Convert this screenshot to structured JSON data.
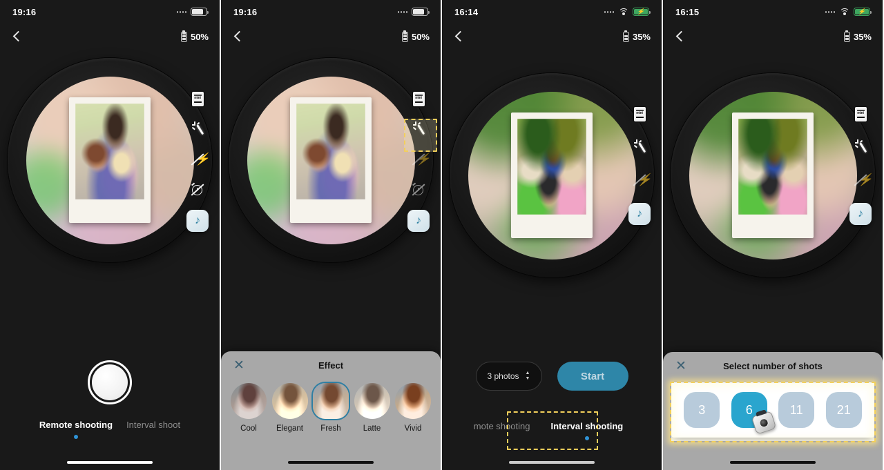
{
  "panels": [
    {
      "id": "remote-shooting",
      "status": {
        "time": "19:16",
        "wifi": false,
        "battery_charging": false
      },
      "nav": {
        "device_battery": "50%"
      },
      "rail": [
        {
          "name": "printer-mini-icon",
          "label": "mini"
        },
        {
          "name": "magic-wand-icon",
          "label": "Effect"
        },
        {
          "name": "flash-off-icon",
          "label": "Flash off"
        },
        {
          "name": "timer-off-icon",
          "label": "Timer off"
        }
      ],
      "music_button": "♪",
      "modes": [
        {
          "label": "Remote shooting",
          "active": true
        },
        {
          "label": "Interval shoot",
          "active": false
        }
      ]
    },
    {
      "id": "effect-sheet",
      "status": {
        "time": "19:16",
        "wifi": false,
        "battery_charging": false
      },
      "nav": {
        "device_battery": "50%"
      },
      "sheet": {
        "title": "Effect",
        "close": "✕",
        "effects": [
          {
            "label": "Cool",
            "selected": false
          },
          {
            "label": "Elegant",
            "selected": false
          },
          {
            "label": "Fresh",
            "selected": true
          },
          {
            "label": "Latte",
            "selected": false
          },
          {
            "label": "Vivid",
            "selected": false
          }
        ]
      }
    },
    {
      "id": "interval-shooting",
      "status": {
        "time": "16:14",
        "wifi": true,
        "battery_charging": true
      },
      "nav": {
        "device_battery": "35%"
      },
      "controls": {
        "photo_count": "3 photos",
        "stepper_up": "▲",
        "stepper_down": "▼",
        "start_label": "Start"
      },
      "modes": [
        {
          "label": "mote shooting",
          "active": false
        },
        {
          "label": "Interval shooting",
          "active": true
        }
      ]
    },
    {
      "id": "select-shots",
      "status": {
        "time": "16:15",
        "wifi": true,
        "battery_charging": true
      },
      "nav": {
        "device_battery": "35%"
      },
      "sheet": {
        "title": "Select number of shots",
        "close": "✕",
        "shots": [
          {
            "label": "3",
            "selected": false
          },
          {
            "label": "6",
            "selected": true
          },
          {
            "label": "11",
            "selected": false
          },
          {
            "label": "21",
            "selected": false
          }
        ]
      }
    }
  ],
  "colors": {
    "accent_blue": "#2f93d6",
    "start_teal": "#2e86a8",
    "selected_shot": "#2aa5ce",
    "unselected_shot": "#b8cbdb",
    "annotation_yellow": "#f2cf5b",
    "sheet_grey": "#a8a8a8"
  }
}
